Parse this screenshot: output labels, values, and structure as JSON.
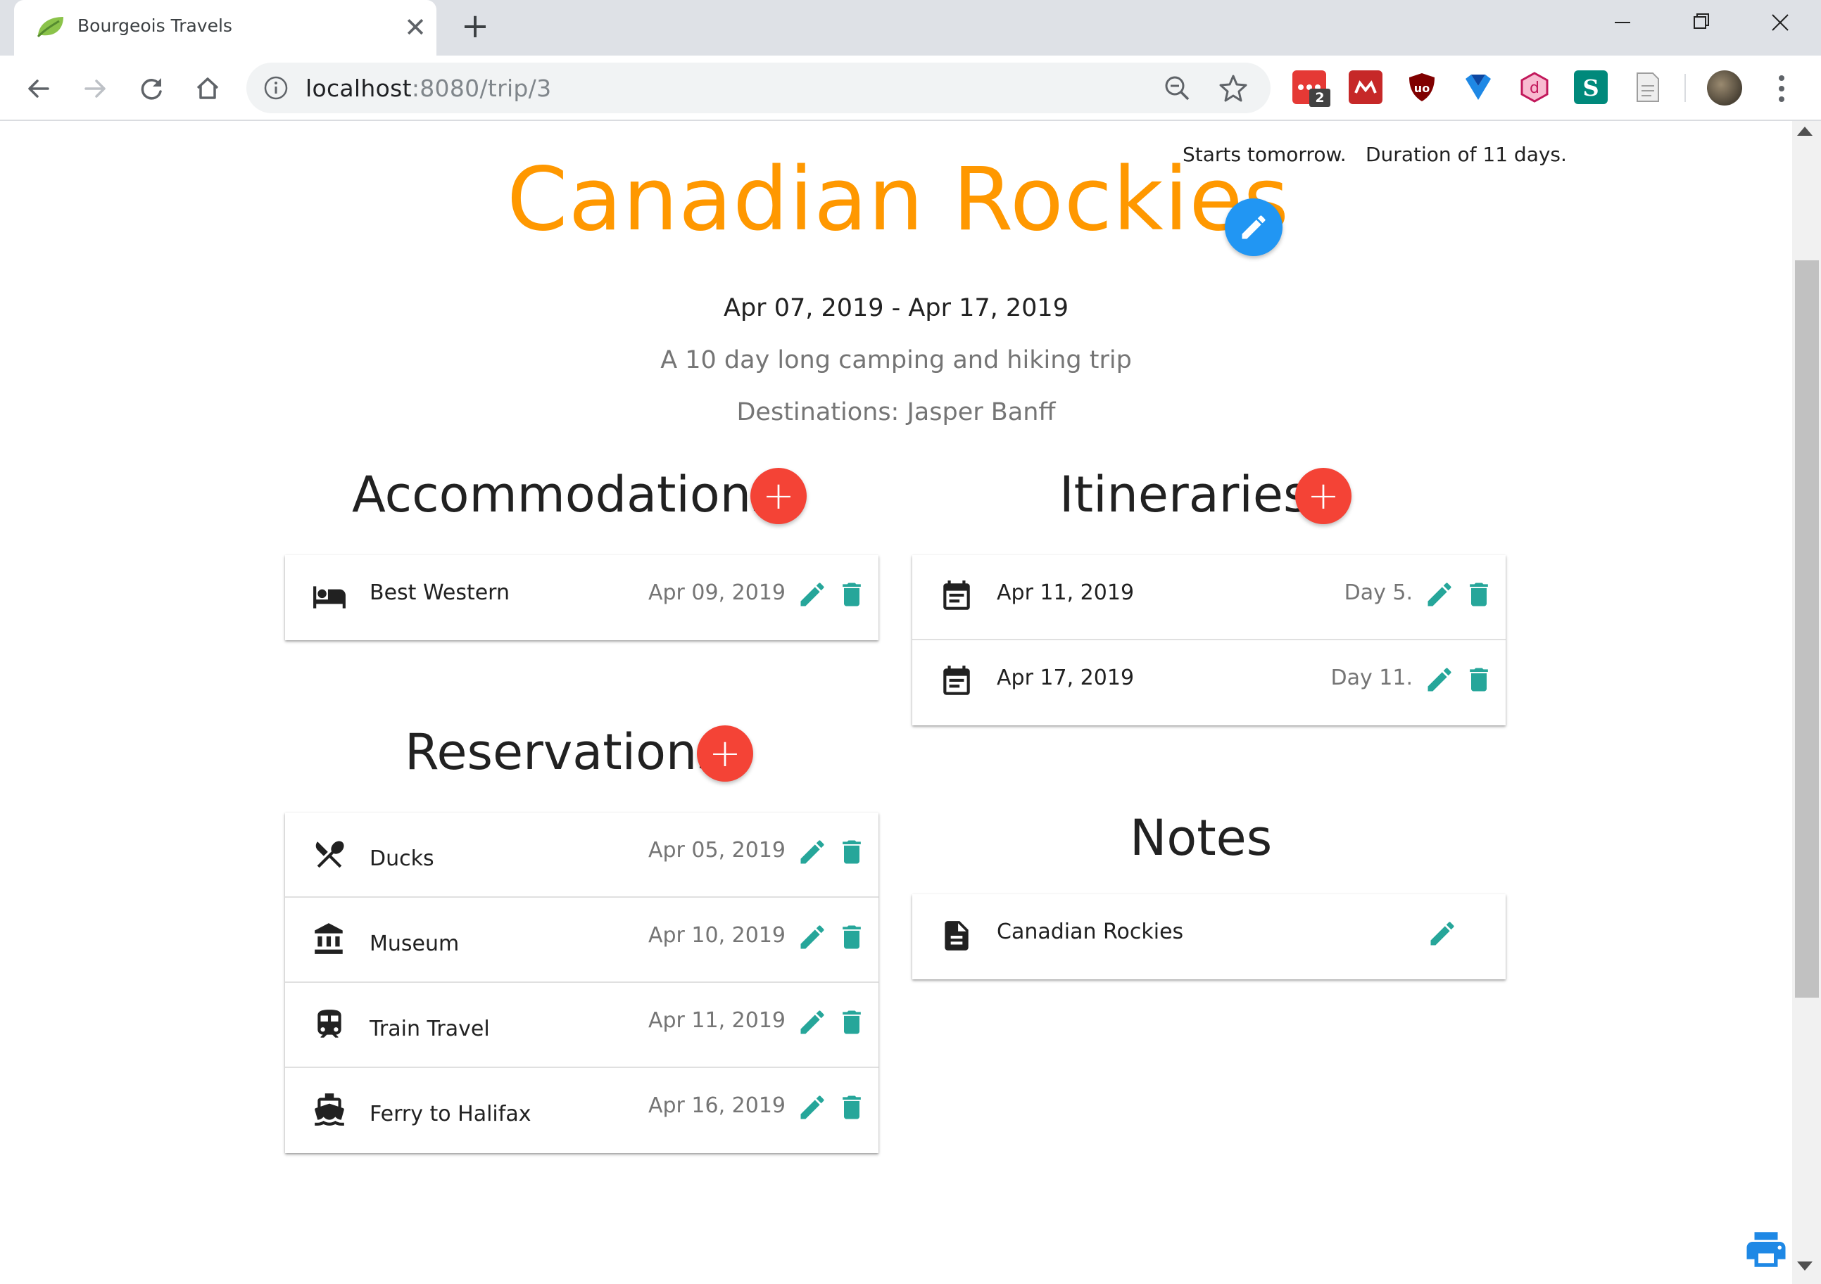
{
  "browser": {
    "tab_title": "Bourgeois Travels",
    "url_host": "localhost",
    "url_path": ":8080/trip/3",
    "extension_badge": "2"
  },
  "trip": {
    "starts_text": "Starts tomorrow.",
    "duration_text": "Duration of 11 days.",
    "title": "Canadian Rockies",
    "date_range": "Apr 07, 2019 - Apr 17, 2019",
    "description": "A 10 day long camping and hiking trip",
    "destinations": "Destinations: Jasper Banff"
  },
  "accommodations": {
    "heading": "Accommodations",
    "items": [
      {
        "icon": "hotel-icon",
        "name": "Best Western",
        "date": "Apr 09, 2019"
      }
    ]
  },
  "itineraries": {
    "heading": "Itineraries",
    "items": [
      {
        "icon": "calendar-icon",
        "date_label": "Apr 11, 2019",
        "day": "Day 5."
      },
      {
        "icon": "calendar-icon",
        "date_label": "Apr 17, 2019",
        "day": "Day 11."
      }
    ]
  },
  "reservations": {
    "heading": "Reservations",
    "items": [
      {
        "icon": "restaurant-icon",
        "name": "Ducks",
        "date": "Apr 05, 2019"
      },
      {
        "icon": "museum-icon",
        "name": "Museum",
        "date": "Apr 10, 2019"
      },
      {
        "icon": "train-icon",
        "name": "Train Travel",
        "date": "Apr 11, 2019"
      },
      {
        "icon": "ferry-icon",
        "name": "Ferry to Halifax",
        "date": "Apr 16, 2019"
      }
    ]
  },
  "notes": {
    "heading": "Notes",
    "items": [
      {
        "icon": "description-icon",
        "title": "Canadian Rockies"
      }
    ]
  },
  "colors": {
    "title_orange": "#ff9800",
    "edit_fab_blue": "#2196f3",
    "add_fab_red": "#f44336",
    "action_teal": "#26a69a",
    "print_blue": "#1e88e5"
  }
}
